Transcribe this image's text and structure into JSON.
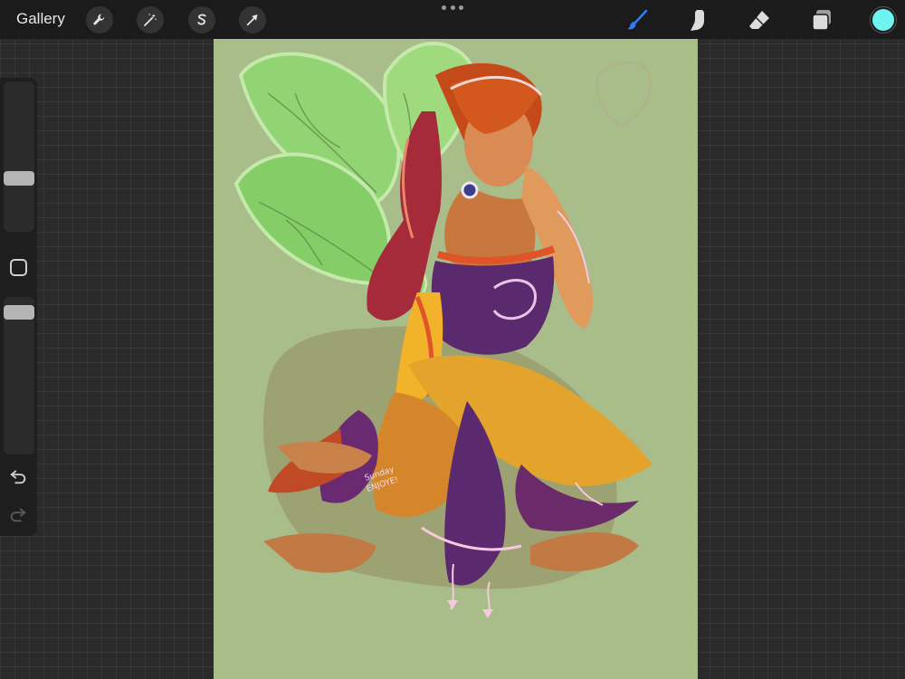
{
  "app": "Procreate",
  "toolbar": {
    "gallery_label": "Gallery",
    "left_tools": [
      {
        "name": "actions",
        "icon": "wrench-icon"
      },
      {
        "name": "adjustments",
        "icon": "magic-wand-icon"
      },
      {
        "name": "selection",
        "icon": "selection-s-icon"
      },
      {
        "name": "transform",
        "icon": "arrow-cursor-icon"
      }
    ],
    "more_menu_icon": "ellipsis-icon",
    "right_tools": [
      {
        "name": "brush",
        "icon": "brush-icon",
        "active": true
      },
      {
        "name": "smudge",
        "icon": "smudge-finger-icon",
        "active": false
      },
      {
        "name": "eraser",
        "icon": "eraser-icon",
        "active": false
      },
      {
        "name": "layers",
        "icon": "layers-icon",
        "active": false
      }
    ],
    "current_color": "#6ff3ee",
    "active_tool_color": "#2e7cf6"
  },
  "sidebar": {
    "brush_size": 0.35,
    "opacity": 1.0,
    "modify_icon": "square-modify-icon",
    "undo_icon": "undo-icon",
    "redo_icon": "redo-icon"
  },
  "canvas": {
    "background_color": "#a9bd8b",
    "artwork": "fairy-painting",
    "signature_text": "Sunday ENJOYE!"
  },
  "colors": {
    "toolbar_bg": "#1b1b1b",
    "workspace_bg": "#2a2a2a"
  }
}
